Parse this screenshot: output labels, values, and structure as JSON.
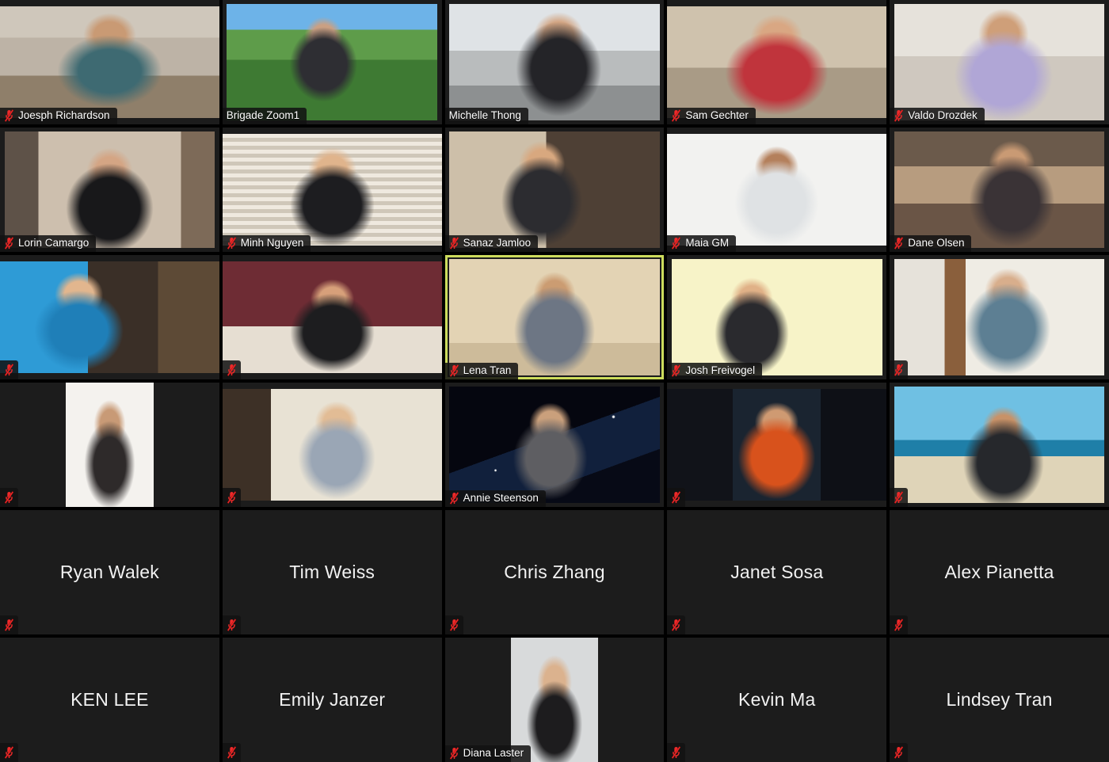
{
  "app": {
    "name": "Zoom Meeting Gallery View",
    "layout": {
      "columns": 5,
      "rows": 6,
      "tile_count": 30
    },
    "colors": {
      "background": "#000000",
      "tile_empty": "#1c1c1c",
      "active_speaker_border": "#cddc5c",
      "mute_icon": "#ee2a2a",
      "name_text": "#ffffff",
      "name_chip_background": "rgba(18,18,18,0.86)"
    },
    "icons": {
      "mute": "microphone-muted-icon"
    }
  },
  "participants": [
    {
      "name": "Joesph Richardson",
      "video_on": true,
      "muted": true,
      "active_speaker": false,
      "name_visible": true,
      "scene": "bg-room-guitar",
      "fit": "letterbox-h"
    },
    {
      "name": "Brigade Zoom1",
      "video_on": true,
      "muted": false,
      "active_speaker": false,
      "name_visible": true,
      "scene": "bg-jungle",
      "fit": "letterbox-s"
    },
    {
      "name": "Michelle Thong",
      "video_on": true,
      "muted": false,
      "active_speaker": false,
      "name_visible": true,
      "scene": "bg-hall",
      "fit": "letterbox-s"
    },
    {
      "name": "Sam Gechter",
      "video_on": true,
      "muted": true,
      "active_speaker": false,
      "name_visible": true,
      "scene": "bg-red",
      "fit": "letterbox-h"
    },
    {
      "name": "Valdo Drozdek",
      "video_on": true,
      "muted": true,
      "active_speaker": false,
      "name_visible": true,
      "scene": "bg-lilac",
      "fit": "letterbox-s"
    },
    {
      "name": "Lorin Camargo",
      "video_on": true,
      "muted": true,
      "active_speaker": false,
      "name_visible": true,
      "scene": "bg-map",
      "fit": "letterbox-s"
    },
    {
      "name": "Minh Nguyen",
      "video_on": true,
      "muted": true,
      "active_speaker": false,
      "name_visible": true,
      "scene": "bg-blinds",
      "fit": "letterbox-h"
    },
    {
      "name": "Sanaz Jamloo",
      "video_on": true,
      "muted": true,
      "active_speaker": false,
      "name_visible": true,
      "scene": "bg-shelf",
      "fit": "letterbox-s"
    },
    {
      "name": "Maia GM",
      "video_on": true,
      "muted": true,
      "active_speaker": false,
      "name_visible": true,
      "scene": "bg-white",
      "fit": "letterbox-h"
    },
    {
      "name": "Dane Olsen",
      "video_on": true,
      "muted": true,
      "active_speaker": false,
      "name_visible": true,
      "scene": "bg-livingroom",
      "fit": "letterbox-s"
    },
    {
      "name": "",
      "video_on": true,
      "muted": true,
      "active_speaker": false,
      "name_visible": false,
      "scene": "bg-teal",
      "fit": "letterbox-h"
    },
    {
      "name": "",
      "video_on": true,
      "muted": true,
      "active_speaker": false,
      "name_visible": false,
      "scene": "bg-maroon",
      "fit": "letterbox-h"
    },
    {
      "name": "Lena Tran",
      "video_on": true,
      "muted": true,
      "active_speaker": true,
      "name_visible": true,
      "scene": "bg-cream-room",
      "fit": "letterbox-s"
    },
    {
      "name": "Josh Freivogel",
      "video_on": true,
      "muted": true,
      "active_speaker": false,
      "name_visible": true,
      "scene": "bg-books",
      "fit": "letterbox-s"
    },
    {
      "name": "",
      "video_on": true,
      "muted": true,
      "active_speaker": false,
      "name_visible": false,
      "scene": "bg-grey-room",
      "fit": "letterbox-s"
    },
    {
      "name": "",
      "video_on": true,
      "muted": true,
      "active_speaker": false,
      "name_visible": false,
      "scene": "bg-portrait-white",
      "fit": "letterbox-v"
    },
    {
      "name": "",
      "video_on": true,
      "muted": true,
      "active_speaker": false,
      "name_visible": false,
      "scene": "bg-art-room",
      "fit": "letterbox-h"
    },
    {
      "name": "Annie Steenson",
      "video_on": true,
      "muted": true,
      "active_speaker": false,
      "name_visible": true,
      "scene": "bg-space",
      "fit": "letterbox-s"
    },
    {
      "name": "",
      "video_on": true,
      "muted": true,
      "active_speaker": false,
      "name_visible": false,
      "scene": "bg-desk-dark",
      "fit": "letterbox-h"
    },
    {
      "name": "",
      "video_on": true,
      "muted": true,
      "active_speaker": false,
      "name_visible": false,
      "scene": "bg-beach",
      "fit": "letterbox-s"
    },
    {
      "name": "Ryan Walek",
      "video_on": false,
      "muted": true,
      "active_speaker": false,
      "name_visible": true,
      "scene": "",
      "fit": ""
    },
    {
      "name": "Tim Weiss",
      "video_on": false,
      "muted": true,
      "active_speaker": false,
      "name_visible": true,
      "scene": "",
      "fit": ""
    },
    {
      "name": "Chris Zhang",
      "video_on": false,
      "muted": true,
      "active_speaker": false,
      "name_visible": true,
      "scene": "",
      "fit": ""
    },
    {
      "name": "Janet Sosa",
      "video_on": false,
      "muted": true,
      "active_speaker": false,
      "name_visible": true,
      "scene": "",
      "fit": ""
    },
    {
      "name": "Alex Pianetta",
      "video_on": false,
      "muted": true,
      "active_speaker": false,
      "name_visible": true,
      "scene": "",
      "fit": ""
    },
    {
      "name": "KEN LEE",
      "video_on": false,
      "muted": true,
      "active_speaker": false,
      "name_visible": true,
      "scene": "",
      "fit": ""
    },
    {
      "name": "Emily Janzer",
      "video_on": false,
      "muted": true,
      "active_speaker": false,
      "name_visible": true,
      "scene": "",
      "fit": ""
    },
    {
      "name": "Diana Laster",
      "video_on": true,
      "muted": true,
      "active_speaker": false,
      "name_visible": true,
      "scene": "bg-headshot",
      "fit": "letterbox-v"
    },
    {
      "name": "Kevin Ma",
      "video_on": false,
      "muted": true,
      "active_speaker": false,
      "name_visible": true,
      "scene": "",
      "fit": ""
    },
    {
      "name": "Lindsey Tran",
      "video_on": false,
      "muted": true,
      "active_speaker": false,
      "name_visible": true,
      "scene": "",
      "fit": ""
    }
  ]
}
